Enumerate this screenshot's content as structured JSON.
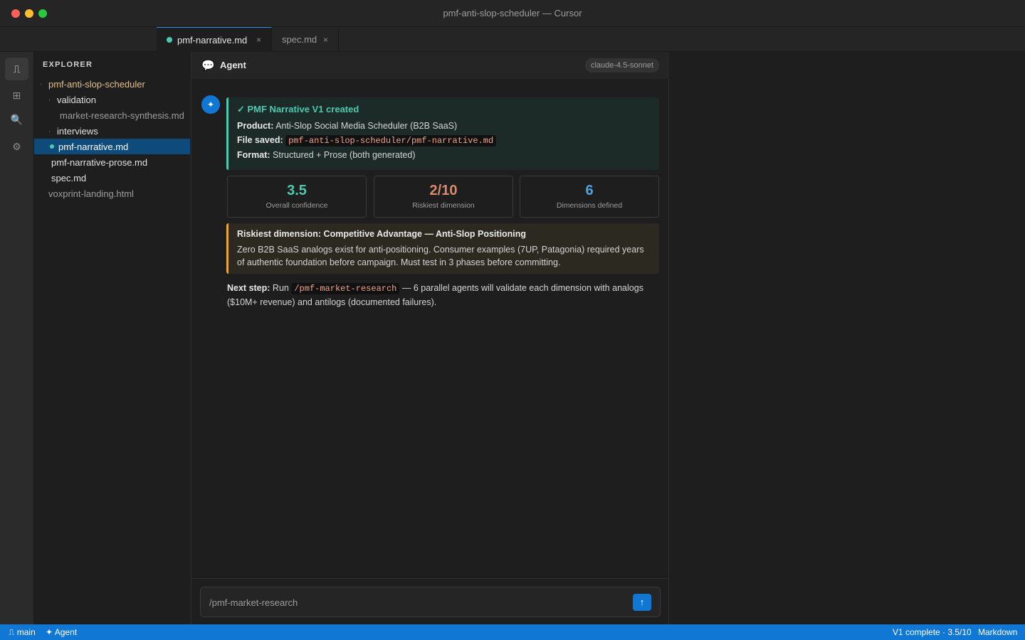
{
  "window": {
    "title": "pmf-anti-slop-scheduler — Cursor"
  },
  "tabs": [
    {
      "label": "pmf-narrative.md",
      "close": "×"
    },
    {
      "label": "spec.md",
      "close": "×"
    }
  ],
  "activity_bar": {
    "items": [
      {
        "icon": "git-branch-icon",
        "glyph": "⎍"
      },
      {
        "icon": "extensions-icon",
        "glyph": "⊞"
      },
      {
        "icon": "search-icon",
        "glyph": "🔍"
      },
      {
        "icon": "settings-icon",
        "glyph": "⚙"
      }
    ]
  },
  "explorer": {
    "title": "EXPLORER",
    "root": "pmf-anti-slop-scheduler",
    "items": [
      {
        "label": "validation"
      },
      {
        "label": "market-research-synthesis.md"
      },
      {
        "label": "interviews"
      },
      {
        "label": "pmf-narrative.md"
      },
      {
        "label": "pmf-narrative-prose.md"
      },
      {
        "label": "spec.md"
      },
      {
        "label": "voxprint-landing.html"
      }
    ]
  },
  "agent": {
    "title": "Agent",
    "model": "claude-4.5-sonnet",
    "avatar": "✦",
    "summary": {
      "title": "✓ PMF Narrative V1 created",
      "product_label": "Product:",
      "product_value": "Anti-Slop Social Media Scheduler (B2B SaaS)",
      "file_label": "File saved:",
      "file_value": "pmf-anti-slop-scheduler/pmf-narrative.md",
      "format_label": "Format:",
      "format_value": "Structured + Prose (both generated)"
    },
    "stats": [
      {
        "value": "3.5",
        "label": "Overall confidence",
        "color": "#4ec9b0"
      },
      {
        "value": "2/10",
        "label": "Riskiest dimension",
        "color": "#d98a6c"
      },
      {
        "value": "6",
        "label": "Dimensions defined",
        "color": "#4fa3e0"
      }
    ],
    "risk": {
      "title": "Riskiest dimension: Competitive Advantage — Anti-Slop Positioning",
      "body": "Zero B2B SaaS analogs exist for anti-positioning. Consumer examples (7UP, Patagonia) required years of authentic foundation before campaign. Must test in 3 phases before committing."
    },
    "next_step": {
      "label": "Next step:",
      "pre": "Run",
      "command": "/pmf-market-research",
      "post": "— 6 parallel agents will validate each dimension with analogs ($10M+ revenue) and antilogs (documented failures)."
    },
    "input": {
      "value": "/pmf-market-research",
      "send_glyph": "↑"
    }
  },
  "status_bar": {
    "branch": "⎍ main",
    "agent": "✦ Agent",
    "progress": "V1 complete · 3.5/10",
    "language": "Markdown"
  },
  "colors": {
    "accent": "#1177d4",
    "success": "#4ec9b0",
    "warning": "#e5a93b"
  }
}
